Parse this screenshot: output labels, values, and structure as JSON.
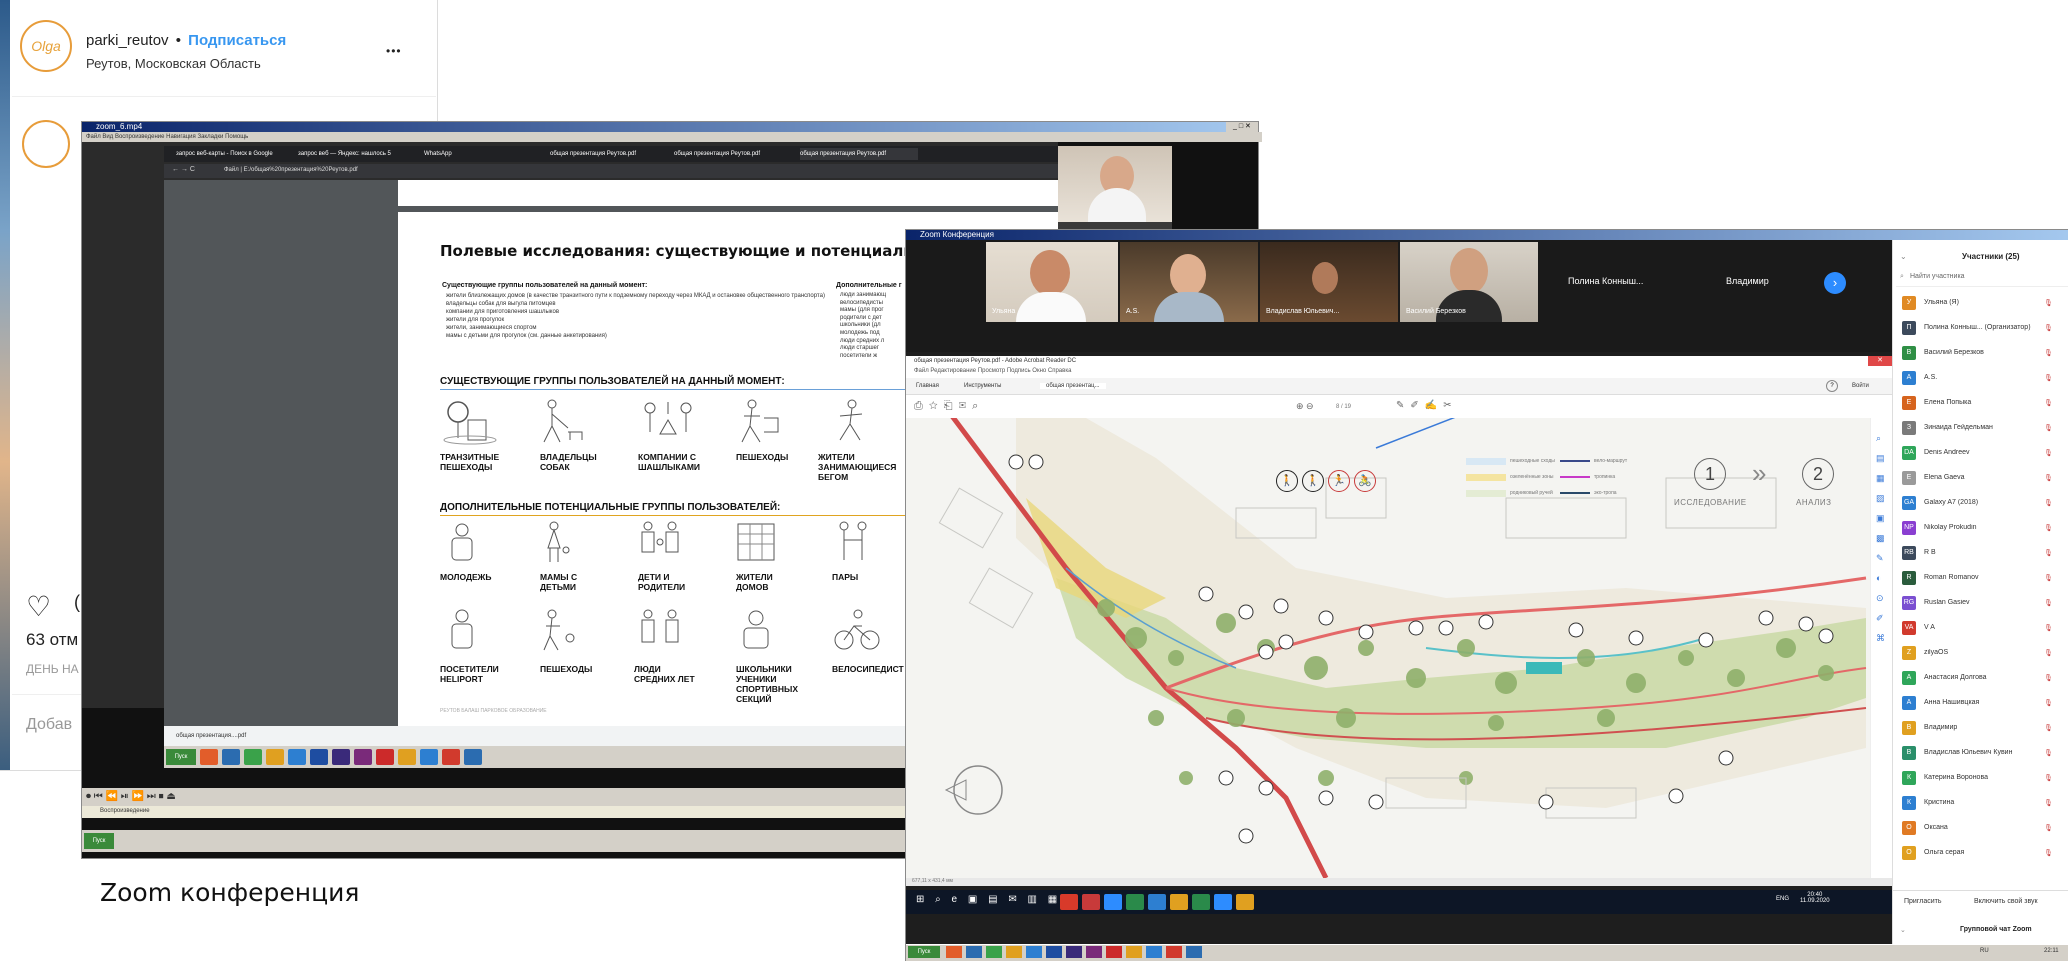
{
  "instagram": {
    "username": "parki_reutov",
    "separator": "•",
    "follow_label": "Подписаться",
    "location": "Реутов, Московская Область",
    "more_label": "•••",
    "avatar_text": "Olga",
    "likes_partial": "63 отм",
    "date_partial": "ДЕНЬ НА",
    "comment_partial": "Добав",
    "heart_partial": "("
  },
  "caption": "Zoom конференция",
  "media_window": {
    "title": "zoom_6.mp4",
    "menu": "Файл  Вид  Воспроизведение  Навигация  Закладки  Помощь",
    "tabs": [
      "запрос веб-карты - Поиск в Google",
      "запрос веб — Яндекс: нашлось 5",
      "WhatsApp",
      "общая презентация Реутов.pdf",
      "общая презентация Реутов.pdf",
      "общая презентация Реутов.pdf"
    ],
    "address": "Файл | E:/общая%20презентация%20Реутов.pdf",
    "bottom_tab": "общая презентация....pdf",
    "status": "Воспроизведение"
  },
  "slide": {
    "title": "Полевые исследования: существующие и потенциальные к",
    "subhead_left": "Существующие группы пользователей на данный момент:",
    "subhead_right": "Дополнительные г",
    "bullets": [
      "жители близлежащих домов (в качестве транзитного пути к подземному переходу через МКАД и остановке общественного транспорта)",
      "владельцы собак для выгула питомцев",
      "компании для приготовления шашлыков",
      "жители для прогулок",
      "жители, занимающиеся спортом",
      "мамы с детьми для прогулок (см. данные анкетирования)"
    ],
    "bullets_right": [
      "люди занимающ",
      "велосипедисты",
      "мамы (для прог",
      "родители с дет",
      "школьники (дл",
      "молодежь под",
      "люди средних л",
      "люди старшег",
      "посетители ж"
    ],
    "section1": "СУЩЕСТВУЮЩИЕ ГРУППЫ ПОЛЬЗОВАТЕЛЕЙ НА ДАННЫЙ МОМЕНТ:",
    "groups1": [
      "ТРАНЗИТНЫЕ ПЕШЕХОДЫ",
      "ВЛАДЕЛЬЦЫ СОБАК",
      "КОМПАНИИ С ШАШЛЫКАМИ",
      "ПЕШЕХОДЫ",
      "ЖИТЕЛИ ЗАНИМАЮЩИЕСЯ БЕГОМ"
    ],
    "section2": "ДОПОЛНИТЕЛЬНЫЕ ПОТЕНЦИАЛЬНЫЕ ГРУППЫ ПОЛЬЗОВАТЕЛЕЙ:",
    "groups2": [
      "МОЛОДЕЖЬ",
      "МАМЫ С ДЕТЬМИ",
      "ДЕТИ И РОДИТЕЛИ",
      "ЖИТЕЛИ ДОМОВ",
      "ПАРЫ"
    ],
    "groups3": [
      "ПОСЕТИТЕЛИ HELIPORT",
      "ПЕШЕХОДЫ",
      "ЛЮДИ СРЕДНИХ ЛЕТ",
      "ШКОЛЬНИКИ УЧЕНИКИ СПОРТИВНЫХ СЕКЦИЙ",
      "ВЕЛОСИПЕДИСТ"
    ],
    "footer": "РЕУТОВ  БАЛАШ ПАРКОВОЕ ОБРАЗОВАНИЕ"
  },
  "zoom": {
    "title": "Zoom Конференция",
    "videos": [
      "Ульяна",
      "A.S.",
      "Владислав Юльевич...",
      "Василий Березков"
    ],
    "name_tiles": [
      "Полина Конныш...",
      "Владимир"
    ],
    "acrobat_title": "общая презентация Реутов.pdf - Adobe Acrobat Reader DC",
    "acrobat_menu": "Файл  Редактирование  Просмотр  Подпись  Окно  Справка",
    "acrobat_tabs": [
      "Главная",
      "Инструменты",
      "общая презентац..."
    ],
    "signin": "Войти",
    "page_indicator": "8 / 19",
    "stage1_num": "1",
    "stage2_num": "2",
    "stage1": "ИССЛЕДОВАНИЕ",
    "stage2": "АНАЛИЗ",
    "arrow": "»",
    "legend": [
      "пешеходные сходы",
      "вело-маршрут",
      "озеленённые зоны",
      "тропинка",
      "родниковый ручей",
      "эко-тропа"
    ],
    "zoom_pct": "677,11 х 431,4 мм",
    "participants_title": "Участники (25)",
    "search_placeholder": "Найти участника",
    "participants": [
      {
        "initial": "У",
        "color": "#e08a24",
        "name": "Ульяна (Я)"
      },
      {
        "initial": "П",
        "color": "#3c4a5c",
        "name": "Полина Конныш... (Организатор)"
      },
      {
        "initial": "В",
        "color": "#2f8f45",
        "name": "Василий Березков"
      },
      {
        "initial": "А",
        "color": "#2d7fd1",
        "name": "A.S."
      },
      {
        "initial": "Е",
        "color": "#d6641e",
        "name": "Елена Попыка"
      },
      {
        "initial": "З",
        "color": "#7a7a7a",
        "name": "Зинаида Гейдельман"
      },
      {
        "initial": "DA",
        "color": "#2fa65a",
        "name": "Denis Andreev"
      },
      {
        "initial": "E",
        "color": "#9a9a9a",
        "name": "Elena Gaeva"
      },
      {
        "initial": "GA",
        "color": "#2d7fd1",
        "name": "Galaxy A7 (2018)"
      },
      {
        "initial": "NP",
        "color": "#8a3fd1",
        "name": "Nikolay Prokudin"
      },
      {
        "initial": "RB",
        "color": "#3c4a5c",
        "name": "R B"
      },
      {
        "initial": "R",
        "color": "#2a5c3c",
        "name": "Roman Romanov"
      },
      {
        "initial": "RG",
        "color": "#7b4fd1",
        "name": "Ruslan Gasiev"
      },
      {
        "initial": "VA",
        "color": "#d13a2d",
        "name": "V A"
      },
      {
        "initial": "Z",
        "color": "#e0a020",
        "name": "zilyaOS"
      },
      {
        "initial": "А",
        "color": "#2fa65a",
        "name": "Анастасия Долгова"
      },
      {
        "initial": "А",
        "color": "#2d7fd1",
        "name": "Анна Нашивцкая"
      },
      {
        "initial": "В",
        "color": "#e0a020",
        "name": "Владимир"
      },
      {
        "initial": "В",
        "color": "#2a8f6a",
        "name": "Владислав Юльевич Кувин"
      },
      {
        "initial": "К",
        "color": "#2fa65a",
        "name": "Катерина Воронова"
      },
      {
        "initial": "К",
        "color": "#2d7fd1",
        "name": "Кристина"
      },
      {
        "initial": "О",
        "color": "#e07a24",
        "name": "Оксана"
      },
      {
        "initial": "О",
        "color": "#e0a020",
        "name": "Ольга серая"
      }
    ],
    "invite": "Пригласить",
    "mute_all": "Включить свой звук",
    "group_chat": "Групповой чат Zoom",
    "clock_time": "20:40",
    "clock_date": "11.09.2020",
    "tray_text": "ENG"
  },
  "taskbar": {
    "start_label": "Пуск",
    "clock": "22:11",
    "lang": "RU"
  }
}
